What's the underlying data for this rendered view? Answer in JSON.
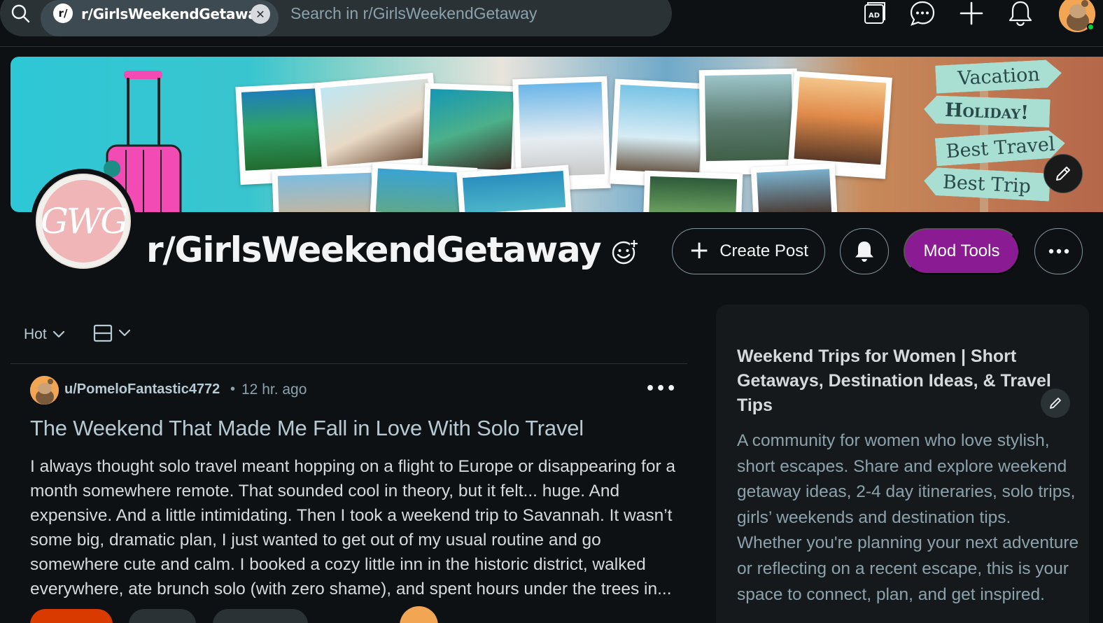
{
  "search": {
    "chip_icon": "r/",
    "chip_label": "r/GirlsWeekendGetaway",
    "placeholder": "Search in r/GirlsWeekendGetaway"
  },
  "topbar_icons": [
    "advertise-icon",
    "chat-icon",
    "create-icon",
    "notifications-icon"
  ],
  "banner": {
    "signs": [
      "Vacation",
      "Holiday!",
      "Best Travel",
      "Best Trip"
    ]
  },
  "community": {
    "avatar_text": "GWG",
    "name": "r/GirlsWeekendGetaway",
    "create_post_label": "Create Post",
    "mod_tools_label": "Mod Tools",
    "mod_tools_color": "#8a1b93"
  },
  "feed": {
    "sort_label": "Hot"
  },
  "post": {
    "username": "u/PomeloFantastic4772",
    "separator": "•",
    "time": "12 hr. ago",
    "more": "•••",
    "title": "The Weekend That Made Me Fall in Love With Solo Travel",
    "body": "I always thought solo travel meant hopping on a flight to Europe or disappearing for a month somewhere remote. That sounded cool in theory, but it felt... huge. And expensive. And a little intimidating. Then I took a weekend trip to Savannah. It wasn’t some big, dramatic plan, I just wanted to get out of my usual routine and go somewhere cute and calm. I booked a cozy little inn in the historic district, walked everywhere, ate brunch solo (with zero shame), and spent hours under the trees in..."
  },
  "sidebar": {
    "title": "Weekend Trips for Women | Short Getaways, Destination Ideas, & Travel Tips",
    "description": "A community for women who love stylish, short escapes. Share and explore weekend getaway ideas, 2-4 day itineraries, solo trips, girls’ weekends and destination tips. Whether you're planning your next adventure or reflecting on a recent escape, this is your space to connect, plan, and get inspired."
  },
  "colors": {
    "background": "#0e1113",
    "upvote": "#d93a00",
    "online": "#02d13a"
  }
}
